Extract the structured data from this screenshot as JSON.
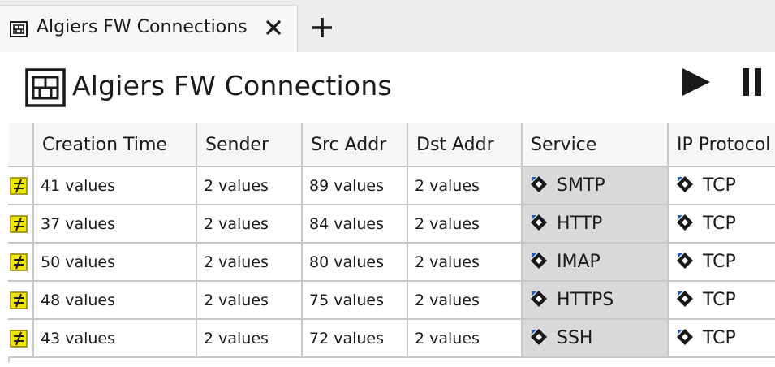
{
  "tab": {
    "label": "Algiers FW Connections",
    "close_icon": "close-icon",
    "add_icon": "plus-icon"
  },
  "panel": {
    "title": "Algiers FW Connections",
    "icon": "firewall-icon",
    "play_icon": "play-icon",
    "pause_icon": "pause-icon"
  },
  "table": {
    "columns": [
      "",
      "Creation Time",
      "Sender",
      "Src Addr",
      "Dst Addr",
      "Service",
      "IP Protocol"
    ],
    "rows": [
      {
        "creation_time": "41 values",
        "sender": "2 values",
        "src_addr": "89 values",
        "dst_addr": "2 values",
        "service": "SMTP",
        "ip_protocol": "TCP"
      },
      {
        "creation_time": "37 values",
        "sender": "2 values",
        "src_addr": "84 values",
        "dst_addr": "2 values",
        "service": "HTTP",
        "ip_protocol": "TCP"
      },
      {
        "creation_time": "50 values",
        "sender": "2 values",
        "src_addr": "80 values",
        "dst_addr": "2 values",
        "service": "IMAP",
        "ip_protocol": "TCP"
      },
      {
        "creation_time": "48 values",
        "sender": "2 values",
        "src_addr": "75 values",
        "dst_addr": "2 values",
        "service": "HTTPS",
        "ip_protocol": "TCP"
      },
      {
        "creation_time": "43 values",
        "sender": "2 values",
        "src_addr": "72 values",
        "dst_addr": "2 values",
        "service": "SSH",
        "ip_protocol": "TCP"
      }
    ],
    "row_flag_icon": "not-equal-icon",
    "service_icon": "diamond-arrow-icon",
    "colors": {
      "flag_fill": "#f2e600",
      "service_bg": "#d9d9d9",
      "grid_line": "#c8c8c8"
    }
  }
}
